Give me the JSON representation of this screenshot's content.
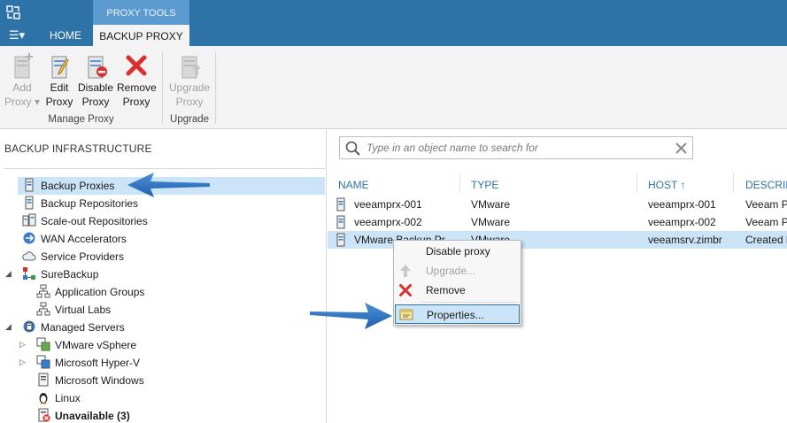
{
  "ribbon_tabs": {
    "menu": "☰▾",
    "home": "HOME",
    "context_group": "PROXY TOOLS",
    "active": "BACKUP PROXY"
  },
  "ribbon": {
    "add_proxy": "Add Proxy ▾",
    "edit_proxy": "Edit Proxy",
    "disable_proxy": "Disable Proxy",
    "remove_proxy": "Remove Proxy",
    "upgrade_proxy": "Upgrade Proxy",
    "group_manage": "Manage Proxy",
    "group_upgrade": "Upgrade"
  },
  "left_panel": {
    "title": "BACKUP INFRASTRUCTURE",
    "items": [
      {
        "label": "Backup Proxies"
      },
      {
        "label": "Backup Repositories"
      },
      {
        "label": "Scale-out Repositories"
      },
      {
        "label": "WAN Accelerators"
      },
      {
        "label": "Service Providers"
      },
      {
        "label": "SureBackup"
      },
      {
        "label": "Application Groups"
      },
      {
        "label": "Virtual Labs"
      },
      {
        "label": "Managed Servers"
      },
      {
        "label": "VMware vSphere"
      },
      {
        "label": "Microsoft Hyper-V"
      },
      {
        "label": "Microsoft Windows"
      },
      {
        "label": "Linux"
      },
      {
        "label": "Unavailable (3)"
      }
    ]
  },
  "search": {
    "placeholder": "Type in an object name to search for"
  },
  "table": {
    "columns": [
      "NAME",
      "TYPE",
      "HOST ↑",
      "DESCRIPT"
    ],
    "rows": [
      {
        "name": "veeamprx-001",
        "type": "VMware",
        "host": "veeamprx-001",
        "desc": "Veeam Pr"
      },
      {
        "name": "veeamprx-002",
        "type": "VMware",
        "host": "veeamprx-002",
        "desc": "Veeam Pr"
      },
      {
        "name": "VMware Backup Pr",
        "type": "VMware",
        "host": "veeamsrv.zimbr",
        "desc": "Created b"
      }
    ]
  },
  "context_menu": {
    "disable": "Disable proxy",
    "upgrade": "Upgrade...",
    "remove": "Remove",
    "properties": "Properties..."
  },
  "colors": {
    "titlebar": "#2e73a8",
    "selection": "#cce4f7",
    "arrow": "#1f5fae"
  }
}
